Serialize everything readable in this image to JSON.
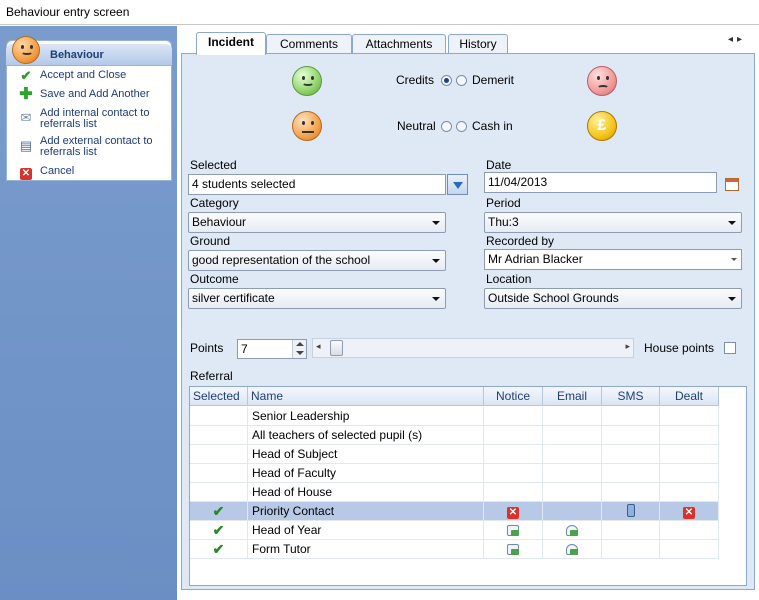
{
  "window": {
    "title": "Behaviour entry screen"
  },
  "sidebar": {
    "header": "Behaviour",
    "actions": [
      {
        "label": "Accept and Close",
        "icon": "check-icon"
      },
      {
        "label": "Save and Add Another",
        "icon": "plus-icon"
      },
      {
        "label_line1": "Add internal contact to",
        "label_line2": "referrals list",
        "icon": "mail-icon"
      },
      {
        "label_line1": "Add external contact to",
        "label_line2": "referrals list",
        "icon": "contact-card-icon"
      },
      {
        "label": "Cancel",
        "icon": "cancel-icon"
      }
    ]
  },
  "tabs": [
    {
      "label": "Incident",
      "active": true
    },
    {
      "label": "Comments",
      "active": false
    },
    {
      "label": "Attachments",
      "active": false
    },
    {
      "label": "History",
      "active": false
    }
  ],
  "type_selector": {
    "credits": "Credits",
    "demerit": "Demerit",
    "neutral": "Neutral",
    "cash_in": "Cash in",
    "selected": "credits"
  },
  "form": {
    "selected": {
      "label": "Selected",
      "value": "4 students selected"
    },
    "date": {
      "label": "Date",
      "value": "11/04/2013"
    },
    "category": {
      "label": "Category",
      "value": "Behaviour"
    },
    "period": {
      "label": "Period",
      "value": "Thu:3"
    },
    "ground": {
      "label": "Ground",
      "value": "good representation of the school"
    },
    "recorded_by": {
      "label": "Recorded by",
      "value": "Mr Adrian Blacker"
    },
    "outcome": {
      "label": "Outcome",
      "value": "silver certificate"
    },
    "location": {
      "label": "Location",
      "value": "Outside School Grounds"
    },
    "points": {
      "label": "Points",
      "value": "7"
    },
    "house_points": {
      "label": "House points",
      "checked": false
    }
  },
  "referral": {
    "label": "Referral",
    "columns": [
      "Selected",
      "Name",
      "Notice",
      "Email",
      "SMS",
      "Dealt"
    ],
    "rows": [
      {
        "name": "Senior Leadership",
        "selected": false,
        "notice": "",
        "email": "",
        "sms": "",
        "dealt": ""
      },
      {
        "name": "All teachers of selected pupil (s)",
        "selected": false,
        "notice": "",
        "email": "",
        "sms": "",
        "dealt": ""
      },
      {
        "name": "Head of Subject",
        "selected": false,
        "notice": "",
        "email": "",
        "sms": "",
        "dealt": ""
      },
      {
        "name": "Head of Faculty",
        "selected": false,
        "notice": "",
        "email": "",
        "sms": "",
        "dealt": ""
      },
      {
        "name": "Head of House",
        "selected": false,
        "notice": "",
        "email": "",
        "sms": "",
        "dealt": ""
      },
      {
        "name": "Priority Contact",
        "selected": true,
        "highlighted": true,
        "notice": "cancel-icon",
        "email": "",
        "sms": "phone-icon",
        "dealt": "cancel-icon"
      },
      {
        "name": "Head of Year",
        "selected": true,
        "notice": "mail-icon",
        "email": "email-icon",
        "sms": "",
        "dealt": ""
      },
      {
        "name": "Form Tutor",
        "selected": true,
        "notice": "mail-icon",
        "email": "email-icon",
        "sms": "",
        "dealt": ""
      }
    ]
  },
  "colors": {
    "sidebar_bg": "#6b8fc4",
    "content_bg": "#dfe8f5",
    "selected_row": "#b7c9e6"
  }
}
